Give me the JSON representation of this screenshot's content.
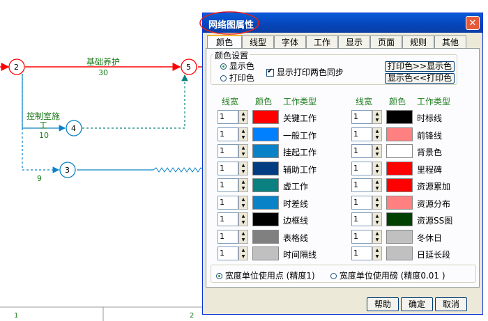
{
  "network": {
    "nodes": [
      "2",
      "5",
      "4",
      "3"
    ],
    "tasks": [
      {
        "name": "基础养护",
        "duration": "30"
      },
      {
        "name_line1": "控制室施",
        "name_line2": "工",
        "duration": "10"
      },
      {
        "duration": "9"
      }
    ],
    "ruler": [
      "1",
      "2"
    ]
  },
  "dialog": {
    "title": "网络图属性",
    "tabs": [
      "颜色",
      "线型",
      "字体",
      "工作",
      "显示",
      "页面",
      "规则",
      "其他"
    ],
    "color_settings": {
      "group_label": "颜色设置",
      "radio_display": "显示色",
      "radio_print": "打印色",
      "sync_label": "显示打印两色同步",
      "btn_print_to_display": "打印色>>显示色",
      "btn_display_to_print": "显示色<<打印色"
    },
    "headers": {
      "width": "线宽",
      "color": "颜色",
      "type": "工作类型"
    },
    "left_rows": [
      {
        "width": "1",
        "color": "#ff0000",
        "label": "关键工作"
      },
      {
        "width": "1",
        "color": "#0080ff",
        "label": "一般工作"
      },
      {
        "width": "1",
        "color": "#0a82c8",
        "label": "挂起工作"
      },
      {
        "width": "1",
        "color": "#003c82",
        "label": "辅助工作"
      },
      {
        "width": "1",
        "color": "#0a8080",
        "label": "虚工作"
      },
      {
        "width": "1",
        "color": "#0a82c8",
        "label": "时差线"
      },
      {
        "width": "1",
        "color": "#000000",
        "label": "边框线"
      },
      {
        "width": "1",
        "color": "#808080",
        "label": "表格线"
      },
      {
        "width": "1",
        "color": "#c0c0c0",
        "label": "时间隔线"
      }
    ],
    "right_rows": [
      {
        "width": "1",
        "color": "#000000",
        "label": "时标线"
      },
      {
        "width": "1",
        "color": "#ff8080",
        "label": "前锋线"
      },
      {
        "width": "1",
        "color": "#ffffff",
        "label": "背景色"
      },
      {
        "width": "1",
        "color": "#ff0000",
        "label": "里程碑"
      },
      {
        "width": "1",
        "color": "#ff0000",
        "label": "资源累加"
      },
      {
        "width": "1",
        "color": "#ff8080",
        "label": "资源分布"
      },
      {
        "width": "1",
        "color": "#004000",
        "label": "资源SS图"
      },
      {
        "width": "1",
        "color": "#c0c0c0",
        "label": "冬休日"
      },
      {
        "width": "1",
        "color": "#c0c0c0",
        "label": "日延长段"
      }
    ],
    "unit_points": "宽度单位使用点 (精度1)",
    "unit_pounds": "宽度单位使用磅 (精度0.01 )",
    "buttons": {
      "help": "帮助",
      "ok": "确定",
      "cancel": "取消"
    }
  }
}
